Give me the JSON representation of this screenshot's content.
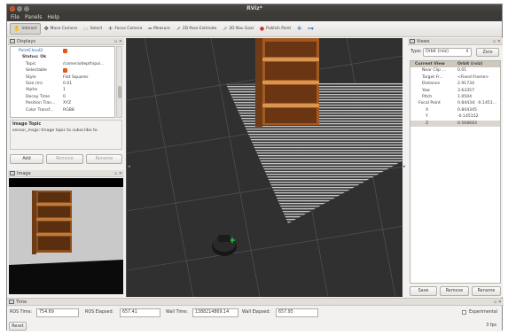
{
  "window": {
    "title": "RViz*"
  },
  "menu": [
    "File",
    "Panels",
    "Help"
  ],
  "toolbar": [
    {
      "label": "Interact",
      "icon": "hand-icon",
      "active": true
    },
    {
      "label": "Move Camera",
      "icon": "move-camera-icon"
    },
    {
      "label": "Select",
      "icon": "select-icon"
    },
    {
      "label": "Focus Camera",
      "icon": "focus-camera-icon"
    },
    {
      "label": "Measure",
      "icon": "measure-icon"
    },
    {
      "label": "2D Pose Estimate",
      "icon": "pose-estimate-icon"
    },
    {
      "label": "2D Nav Goal",
      "icon": "nav-goal-icon"
    },
    {
      "label": "Publish Point",
      "icon": "publish-point-icon"
    },
    {
      "label": "",
      "icon": "crosshair-icon"
    },
    {
      "label": "",
      "icon": "add-tool-icon"
    }
  ],
  "displays": {
    "title": "Displays",
    "rows": [
      {
        "key": "PointCloud2",
        "value": "",
        "indent": 1,
        "blue": true,
        "check": true
      },
      {
        "key": "Status: Ok",
        "value": "",
        "indent": 2,
        "bold": true
      },
      {
        "key": "Topic",
        "value": "/camera/depth/poi...",
        "indent": 3
      },
      {
        "key": "Selectable",
        "value": "",
        "indent": 3,
        "check": true
      },
      {
        "key": "Style",
        "value": "Flat Squares",
        "indent": 3
      },
      {
        "key": "Size (m)",
        "value": "0.01",
        "indent": 3
      },
      {
        "key": "Alpha",
        "value": "1",
        "indent": 3
      },
      {
        "key": "Decay Time",
        "value": "0",
        "indent": 3
      },
      {
        "key": "Position Tran...",
        "value": "XYZ",
        "indent": 3
      },
      {
        "key": "Color Transf...",
        "value": "RGB8",
        "indent": 3
      }
    ],
    "help_title": "Image Topic",
    "help_text": "sensor_msgs::Image topic to subscribe to.",
    "buttons": {
      "add": "Add",
      "remove": "Remove",
      "rename": "Rename"
    }
  },
  "image_panel": {
    "title": "Image"
  },
  "views": {
    "title": "Views",
    "type_label": "Type:",
    "type_value": "Orbit (rviz)",
    "zero": "Zero",
    "rows": [
      {
        "key": "Current View",
        "value": "Orbit (rviz)",
        "indent": 0,
        "head": true
      },
      {
        "key": "Near Clip ...",
        "value": "0.01",
        "indent": 2
      },
      {
        "key": "Target Fr...",
        "value": "<Fixed Frame>",
        "indent": 2
      },
      {
        "key": "Distance",
        "value": "2.91734",
        "indent": 2
      },
      {
        "key": "Yaw",
        "value": "3.63357",
        "indent": 2
      },
      {
        "key": "Pitch",
        "value": "1.0504",
        "indent": 2
      },
      {
        "key": "Focal Point",
        "value": "0.84434; -0.1451...",
        "indent": 1
      },
      {
        "key": "X",
        "value": "0.844345",
        "indent": 3
      },
      {
        "key": "Y",
        "value": "-0.145152",
        "indent": 3
      },
      {
        "key": "Z",
        "value": "0.568683",
        "indent": 3,
        "hl": true
      }
    ],
    "buttons": {
      "save": "Save",
      "remove": "Remove",
      "rename": "Rename"
    }
  },
  "time": {
    "title": "Time",
    "ros_time_label": "ROS Time:",
    "ros_time": "754.69",
    "ros_elapsed_label": "ROS Elapsed:",
    "ros_elapsed": "657.41",
    "wall_time_label": "Wall Time:",
    "wall_time": "1388214869.14",
    "wall_elapsed_label": "Wall Elapsed:",
    "wall_elapsed": "657.95",
    "experimental": "Experimental"
  },
  "status": {
    "reset": "Reset",
    "fps": "3 fps"
  }
}
